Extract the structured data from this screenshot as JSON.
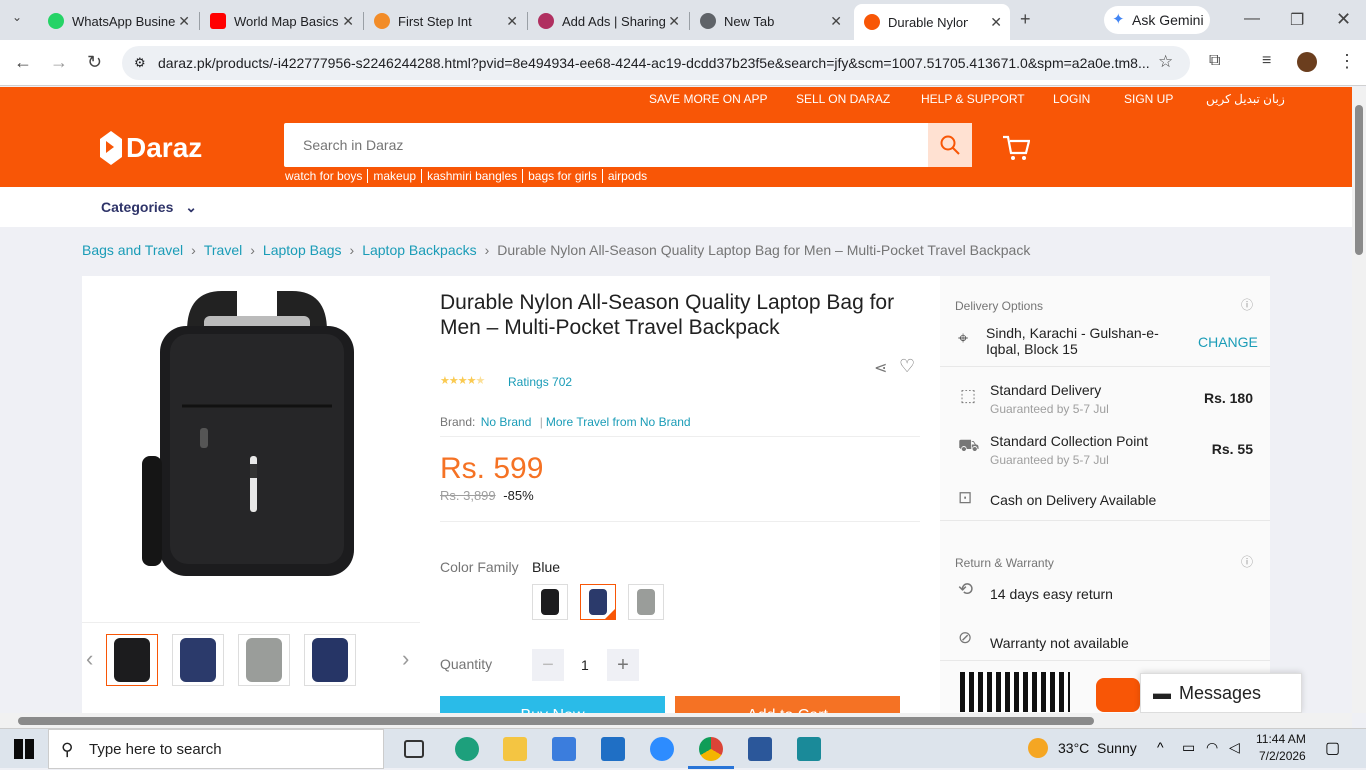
{
  "browser": {
    "tabs": [
      {
        "title": "WhatsApp Busine",
        "color": "#25d366"
      },
      {
        "title": "World Map Basics",
        "color": "#ff0000"
      },
      {
        "title": "First Step Int",
        "color": "#f28c28"
      },
      {
        "title": "Add Ads | Sharing",
        "color": "#b03060"
      },
      {
        "title": "New Tab",
        "color": "#5f6368"
      },
      {
        "title": "Durable Nylon All",
        "color": "#f85606"
      }
    ],
    "ask_gemini": "Ask Gemini",
    "url": "daraz.pk/products/-i422777956-s2246244288.html?pvid=8e494934-ee68-4244-ac19-dcdd37b23f5e&search=jfy&scm=1007.51705.413671.0&spm=a2a0e.tm8..."
  },
  "site": {
    "accent": "#f85606",
    "top_links": [
      "SAVE MORE ON APP",
      "SELL ON DARAZ",
      "HELP & SUPPORT",
      "LOGIN",
      "SIGN UP",
      "زبان تبدیل کریں"
    ],
    "logo": "Daraz",
    "search_placeholder": "Search in Daraz",
    "suggestions": [
      "watch for boys",
      "makeup",
      "kashmiri bangles",
      "bags for girls",
      "airpods"
    ],
    "categories_label": "Categories"
  },
  "breadcrumb": [
    "Bags and Travel",
    "Travel",
    "Laptop Bags",
    "Laptop Backpacks",
    "Durable Nylon All-Season Quality Laptop Bag for Men – Multi-Pocket Travel Backpack"
  ],
  "product": {
    "title": "Durable Nylon All-Season Quality Laptop Bag for Men – Multi-Pocket Travel Backpack",
    "rating_stars": 4.5,
    "ratings_text": "Ratings 702",
    "brand_label": "Brand:",
    "brand": "No Brand",
    "more_from": "More Travel from No Brand",
    "price": "Rs. 599",
    "old_price": "Rs. 3,899",
    "discount": "-85%",
    "color_label": "Color Family",
    "color_value": "Blue",
    "quantity_label": "Quantity",
    "quantity": "1",
    "buy_now": "Buy Now",
    "add_to_cart": "Add to Cart"
  },
  "delivery": {
    "title": "Delivery Options",
    "location": "Sindh, Karachi - Gulshan-e-Iqbal, Block 15",
    "change": "CHANGE",
    "options": [
      {
        "name": "Standard Delivery",
        "sub": "Guaranteed by 5-7 Jul",
        "price": "Rs. 180"
      },
      {
        "name": "Standard Collection Point",
        "sub": "Guaranteed by 5-7 Jul",
        "price": "Rs. 55"
      }
    ],
    "cod": "Cash on Delivery Available",
    "return_title": "Return & Warranty",
    "return": "14 days easy return",
    "warranty": "Warranty not available"
  },
  "messages": "Messages",
  "taskbar": {
    "search_placeholder": "Type here to search",
    "weather": "33°C  Sunny",
    "time": "11:44 AM",
    "date": "7/2/2026"
  }
}
